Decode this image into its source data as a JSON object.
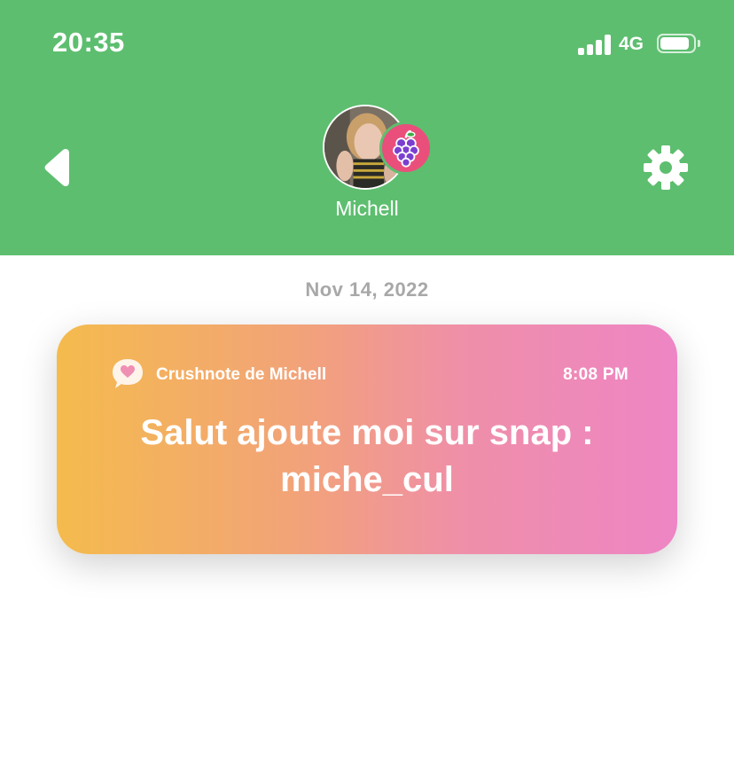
{
  "status_bar": {
    "time": "20:35",
    "network": "4G",
    "signal_bars": 4,
    "battery_level": 0.9
  },
  "header": {
    "profile_name": "Michell",
    "back_icon": "back-triangle-icon",
    "settings_icon": "gear-icon",
    "badge_icon": "grapes-icon",
    "background_color": "#5dbe6f"
  },
  "conversation": {
    "date": "Nov 14, 2022",
    "note": {
      "sender_label": "Crushnote de Michell",
      "time": "8:08 PM",
      "message": "Salut ajoute moi sur snap : miche_cul",
      "icon": "heart-speech-bubble-icon",
      "gradient_start": "#f4bb4d",
      "gradient_end": "#ee85c5"
    }
  }
}
